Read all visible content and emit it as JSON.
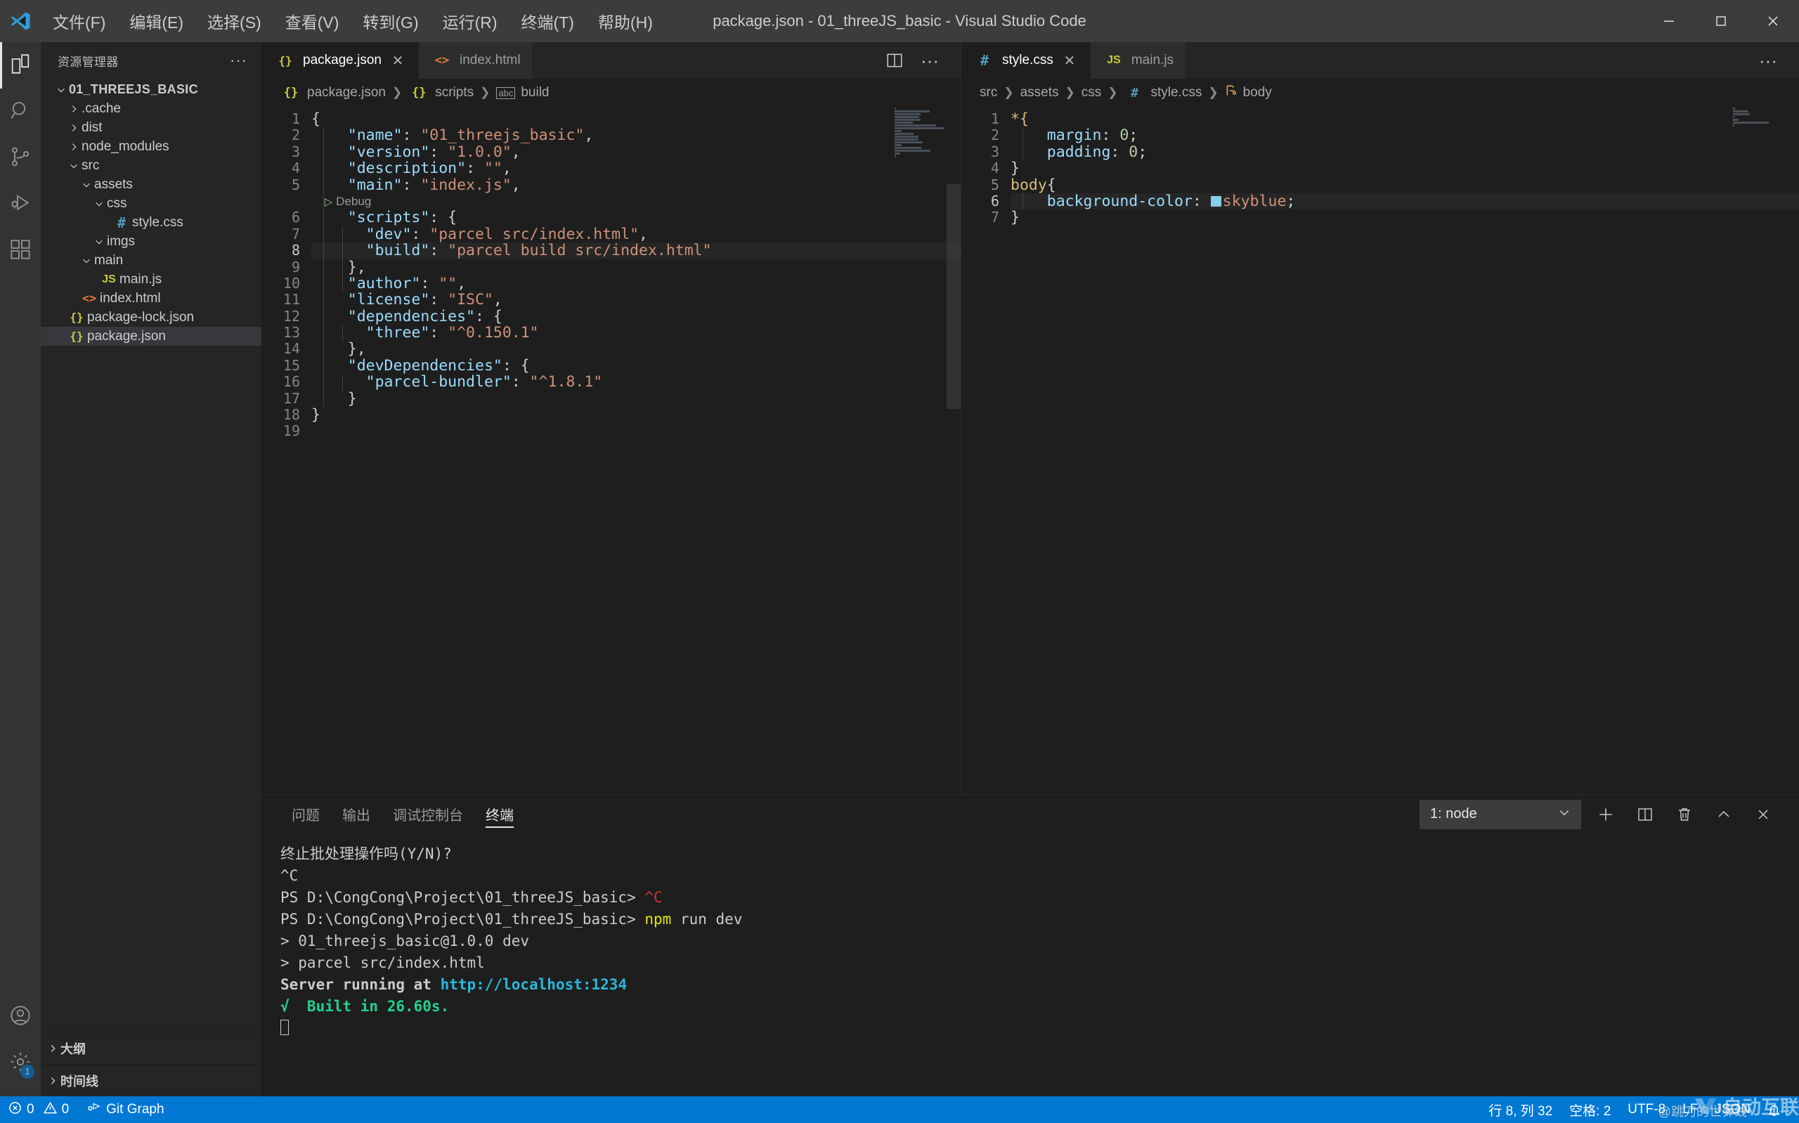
{
  "window": {
    "title": "package.json - 01_threeJS_basic - Visual Studio Code",
    "menu": [
      "文件(F)",
      "编辑(E)",
      "选择(S)",
      "查看(V)",
      "转到(G)",
      "运行(R)",
      "终端(T)",
      "帮助(H)"
    ],
    "controls": {
      "minimize": "—",
      "maximize": "▢",
      "close": "✕"
    }
  },
  "activitybar": {
    "items": [
      {
        "name": "explorer",
        "icon": "files-icon"
      },
      {
        "name": "search",
        "icon": "search-icon"
      },
      {
        "name": "source-control",
        "icon": "source-control-icon"
      },
      {
        "name": "run-debug",
        "icon": "run-debug-icon"
      },
      {
        "name": "extensions",
        "icon": "extensions-icon"
      }
    ],
    "bottom": [
      {
        "name": "account",
        "icon": "account-icon"
      },
      {
        "name": "manage",
        "icon": "gear-icon",
        "badge": "1"
      }
    ]
  },
  "sidebar": {
    "header": "资源管理器",
    "more": "···",
    "root": "01_THREEJS_BASIC",
    "tree": [
      {
        "label": ".cache",
        "indent": 1,
        "type": "folder",
        "expanded": false
      },
      {
        "label": "dist",
        "indent": 1,
        "type": "folder",
        "expanded": false
      },
      {
        "label": "node_modules",
        "indent": 1,
        "type": "folder",
        "expanded": false
      },
      {
        "label": "src",
        "indent": 1,
        "type": "folder",
        "expanded": true
      },
      {
        "label": "assets",
        "indent": 2,
        "type": "folder",
        "expanded": true
      },
      {
        "label": "css",
        "indent": 3,
        "type": "folder",
        "expanded": true
      },
      {
        "label": "style.css",
        "indent": 4,
        "type": "css"
      },
      {
        "label": "imgs",
        "indent": 3,
        "type": "folder",
        "expanded": true
      },
      {
        "label": "main",
        "indent": 2,
        "type": "folder",
        "expanded": true
      },
      {
        "label": "main.js",
        "indent": 3,
        "type": "js"
      },
      {
        "label": "index.html",
        "indent": 2,
        "type": "html"
      },
      {
        "label": "package-lock.json",
        "indent": 1,
        "type": "json"
      },
      {
        "label": "package.json",
        "indent": 1,
        "type": "json",
        "selected": true
      }
    ],
    "sections": [
      "大纲",
      "时间线"
    ]
  },
  "editor_left": {
    "tabs": [
      {
        "label": "package.json",
        "icon": "json-icon",
        "active": true,
        "closable": true
      },
      {
        "label": "index.html",
        "icon": "html-icon",
        "active": false,
        "closable": false
      }
    ],
    "actions": [
      "split-editor-icon",
      "more-actions-icon"
    ],
    "breadcrumb": [
      "package.json",
      "scripts",
      "build"
    ],
    "codelens": "Debug",
    "language": "json",
    "lines": [
      {
        "n": 1,
        "tokens": [
          {
            "t": "{",
            "c": "p"
          }
        ]
      },
      {
        "n": 2,
        "tokens": [
          {
            "t": "    ",
            "c": "p"
          },
          {
            "t": "\"name\"",
            "c": "k"
          },
          {
            "t": ": ",
            "c": "p"
          },
          {
            "t": "\"01_threejs_basic\"",
            "c": "s"
          },
          {
            "t": ",",
            "c": "p"
          }
        ]
      },
      {
        "n": 3,
        "tokens": [
          {
            "t": "    ",
            "c": "p"
          },
          {
            "t": "\"version\"",
            "c": "k"
          },
          {
            "t": ": ",
            "c": "p"
          },
          {
            "t": "\"1.0.0\"",
            "c": "s"
          },
          {
            "t": ",",
            "c": "p"
          }
        ]
      },
      {
        "n": 4,
        "tokens": [
          {
            "t": "    ",
            "c": "p"
          },
          {
            "t": "\"description\"",
            "c": "k"
          },
          {
            "t": ": ",
            "c": "p"
          },
          {
            "t": "\"\"",
            "c": "s"
          },
          {
            "t": ",",
            "c": "p"
          }
        ]
      },
      {
        "n": 5,
        "tokens": [
          {
            "t": "    ",
            "c": "p"
          },
          {
            "t": "\"main\"",
            "c": "k"
          },
          {
            "t": ": ",
            "c": "p"
          },
          {
            "t": "\"index.js\"",
            "c": "s"
          },
          {
            "t": ",",
            "c": "p"
          }
        ]
      },
      {
        "n": 6,
        "tokens": [
          {
            "t": "    ",
            "c": "p"
          },
          {
            "t": "\"scripts\"",
            "c": "k"
          },
          {
            "t": ": ",
            "c": "p"
          },
          {
            "t": "{",
            "c": "p"
          }
        ]
      },
      {
        "n": 7,
        "tokens": [
          {
            "t": "      ",
            "c": "p"
          },
          {
            "t": "\"dev\"",
            "c": "k"
          },
          {
            "t": ": ",
            "c": "p"
          },
          {
            "t": "\"parcel src/index.html\"",
            "c": "s"
          },
          {
            "t": ",",
            "c": "p"
          }
        ]
      },
      {
        "n": 8,
        "tokens": [
          {
            "t": "      ",
            "c": "p"
          },
          {
            "t": "\"build\"",
            "c": "k"
          },
          {
            "t": ": ",
            "c": "p"
          },
          {
            "t": "\"parcel build src/index.html\"",
            "c": "s"
          }
        ],
        "highlight": true
      },
      {
        "n": 9,
        "tokens": [
          {
            "t": "    ",
            "c": "p"
          },
          {
            "t": "},",
            "c": "p"
          }
        ]
      },
      {
        "n": 10,
        "tokens": [
          {
            "t": "    ",
            "c": "p"
          },
          {
            "t": "\"author\"",
            "c": "k"
          },
          {
            "t": ": ",
            "c": "p"
          },
          {
            "t": "\"\"",
            "c": "s"
          },
          {
            "t": ",",
            "c": "p"
          }
        ]
      },
      {
        "n": 11,
        "tokens": [
          {
            "t": "    ",
            "c": "p"
          },
          {
            "t": "\"license\"",
            "c": "k"
          },
          {
            "t": ": ",
            "c": "p"
          },
          {
            "t": "\"ISC\"",
            "c": "s"
          },
          {
            "t": ",",
            "c": "p"
          }
        ]
      },
      {
        "n": 12,
        "tokens": [
          {
            "t": "    ",
            "c": "p"
          },
          {
            "t": "\"dependencies\"",
            "c": "k"
          },
          {
            "t": ": ",
            "c": "p"
          },
          {
            "t": "{",
            "c": "p"
          }
        ]
      },
      {
        "n": 13,
        "tokens": [
          {
            "t": "      ",
            "c": "p"
          },
          {
            "t": "\"three\"",
            "c": "k"
          },
          {
            "t": ": ",
            "c": "p"
          },
          {
            "t": "\"^0.150.1\"",
            "c": "s"
          }
        ]
      },
      {
        "n": 14,
        "tokens": [
          {
            "t": "    ",
            "c": "p"
          },
          {
            "t": "},",
            "c": "p"
          }
        ]
      },
      {
        "n": 15,
        "tokens": [
          {
            "t": "    ",
            "c": "p"
          },
          {
            "t": "\"devDependencies\"",
            "c": "k"
          },
          {
            "t": ": ",
            "c": "p"
          },
          {
            "t": "{",
            "c": "p"
          }
        ]
      },
      {
        "n": 16,
        "tokens": [
          {
            "t": "      ",
            "c": "p"
          },
          {
            "t": "\"parcel-bundler\"",
            "c": "k"
          },
          {
            "t": ": ",
            "c": "p"
          },
          {
            "t": "\"^1.8.1\"",
            "c": "s"
          }
        ]
      },
      {
        "n": 17,
        "tokens": [
          {
            "t": "    ",
            "c": "p"
          },
          {
            "t": "}",
            "c": "p"
          }
        ]
      },
      {
        "n": 18,
        "tokens": [
          {
            "t": "}",
            "c": "p"
          }
        ]
      },
      {
        "n": 19,
        "tokens": []
      }
    ]
  },
  "editor_right": {
    "tabs": [
      {
        "label": "style.css",
        "icon": "css-icon",
        "active": true,
        "closable": true
      },
      {
        "label": "main.js",
        "icon": "js-icon",
        "active": false,
        "closable": false
      }
    ],
    "actions": [
      "more-actions-icon"
    ],
    "breadcrumb": [
      "src",
      "assets",
      "css",
      "style.css",
      "body"
    ],
    "language": "css",
    "lines": [
      {
        "n": 1,
        "tokens": [
          {
            "t": "*{",
            "c": "sel"
          }
        ]
      },
      {
        "n": 2,
        "tokens": [
          {
            "t": "    ",
            "c": "p"
          },
          {
            "t": "margin",
            "c": "k"
          },
          {
            "t": ": ",
            "c": "p"
          },
          {
            "t": "0",
            "c": "num"
          },
          {
            "t": ";",
            "c": "p"
          }
        ]
      },
      {
        "n": 3,
        "tokens": [
          {
            "t": "    ",
            "c": "p"
          },
          {
            "t": "padding",
            "c": "k"
          },
          {
            "t": ": ",
            "c": "p"
          },
          {
            "t": "0",
            "c": "num"
          },
          {
            "t": ";",
            "c": "p"
          }
        ]
      },
      {
        "n": 4,
        "tokens": [
          {
            "t": "}",
            "c": "p"
          }
        ]
      },
      {
        "n": 5,
        "tokens": [
          {
            "t": "body",
            "c": "sel"
          },
          {
            "t": "{",
            "c": "p"
          }
        ]
      },
      {
        "n": 6,
        "tokens": [
          {
            "t": "    ",
            "c": "p"
          },
          {
            "t": "background-color",
            "c": "k"
          },
          {
            "t": ": ",
            "c": "p"
          },
          {
            "t": "__SWATCH__",
            "c": "swatch"
          },
          {
            "t": "skyblue",
            "c": "s"
          },
          {
            "t": ";",
            "c": "p"
          }
        ],
        "highlight": true
      },
      {
        "n": 7,
        "tokens": [
          {
            "t": "}",
            "c": "p"
          }
        ]
      }
    ],
    "color_swatch": "#87ceeb"
  },
  "panel": {
    "tabs": [
      "问题",
      "输出",
      "调试控制台",
      "终端"
    ],
    "active_tab": "终端",
    "terminal_select": "1: node",
    "actions": [
      "new-terminal-icon",
      "split-terminal-icon",
      "kill-terminal-icon",
      "maximize-panel-icon",
      "close-panel-icon"
    ],
    "terminal_lines": [
      [
        {
          "t": "终止批处理操作吗(Y/N)?",
          "c": ""
        }
      ],
      [
        {
          "t": "^C",
          "c": ""
        }
      ],
      [
        {
          "t": "PS D:\\CongCong\\Project\\01_threeJS_basic> ",
          "c": ""
        },
        {
          "t": "^C",
          "c": "t-red"
        }
      ],
      [
        {
          "t": "PS D:\\CongCong\\Project\\01_threeJS_basic> ",
          "c": ""
        },
        {
          "t": "npm",
          "c": "t-yellow"
        },
        {
          "t": " run dev",
          "c": ""
        }
      ],
      [
        {
          "t": "",
          "c": ""
        }
      ],
      [
        {
          "t": "> 01_threejs_basic@1.0.0 dev",
          "c": ""
        }
      ],
      [
        {
          "t": "> parcel src/index.html",
          "c": ""
        }
      ],
      [
        {
          "t": "",
          "c": ""
        }
      ],
      [
        {
          "t": "Server running at ",
          "c": "t-bold"
        },
        {
          "t": "http://localhost:1234",
          "c": "t-cyan t-bold"
        }
      ],
      [
        {
          "t": "√  Built in 26.60s.",
          "c": "t-green t-bold"
        }
      ],
      [
        {
          "t": "__CURSOR__",
          "c": "cursor"
        }
      ]
    ]
  },
  "statusbar": {
    "errors": "0",
    "warnings": "0",
    "git_graph": "Git Graph",
    "line_col": "行 8, 列 32",
    "spaces": "空格: 2",
    "encoding": "UTF-8",
    "eol": "LF",
    "language": "JSON",
    "bell": "🔔",
    "watermark": "自动互联",
    "watermark_sub": "@跳刀的世界线"
  }
}
